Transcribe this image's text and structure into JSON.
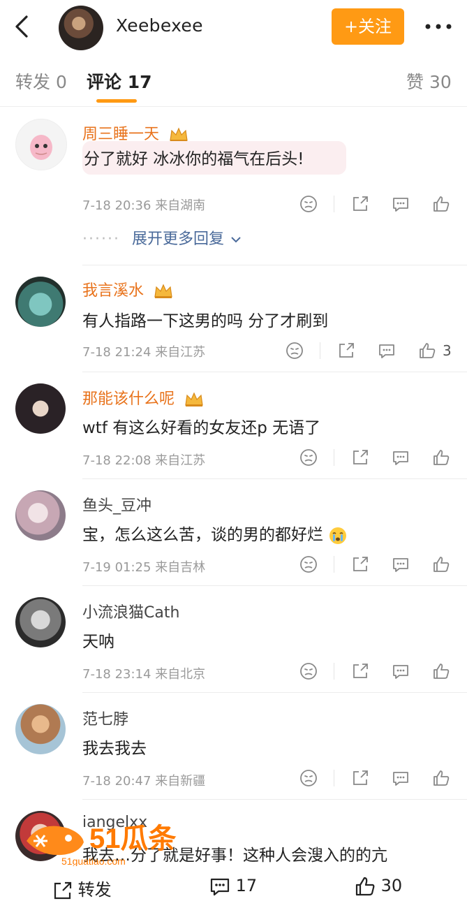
{
  "header": {
    "username": "Xeebexee",
    "follow_label": "+关注"
  },
  "tabs": [
    {
      "label": "转发 0"
    },
    {
      "label": "评论 17"
    },
    {
      "label": "赞 30"
    }
  ],
  "comments": [
    {
      "name": "周三睡一天",
      "text": "分了就好 冰冰你的福气在后头!",
      "time": "7-18 20:36",
      "location": "来自湖南",
      "likes": ""
    },
    {
      "name": "我言溪水",
      "text": "有人指路一下这男的吗 分了才刷到",
      "time": "7-18 21:24",
      "location": "来自江苏",
      "likes": "3"
    },
    {
      "name": "那能该什么呢",
      "text": "wtf 有这么好看的女友还p 无语了",
      "time": "7-18 22:08",
      "location": "来自江苏",
      "likes": ""
    },
    {
      "name": "鱼头_豆冲",
      "text": "宝，怎么这么苦，谈的男的都好烂",
      "time": "7-19 01:25",
      "location": "来自吉林",
      "likes": ""
    },
    {
      "name": "小流浪猫Cath",
      "text": "天呐",
      "time": "7-18 23:14",
      "location": "来自北京",
      "likes": ""
    },
    {
      "name": "范七脖",
      "text": "我去我去",
      "time": "7-18 20:47",
      "location": "来自新疆",
      "likes": ""
    },
    {
      "name": "iangelxx",
      "text": "我去…分了就是好事！这种人会溲入的的亢",
      "time": "",
      "location": "",
      "likes": ""
    }
  ],
  "expand_label": "展开更多回复",
  "bottom": {
    "repost_label": "转发",
    "comment_count": "17",
    "like_count": "30"
  },
  "watermark": {
    "brand": "51瓜条",
    "domain": "51guatiao.com"
  },
  "colors": {
    "accent": "#ff9a14",
    "vip_name": "#e8731c",
    "link": "#4a6a9a"
  }
}
